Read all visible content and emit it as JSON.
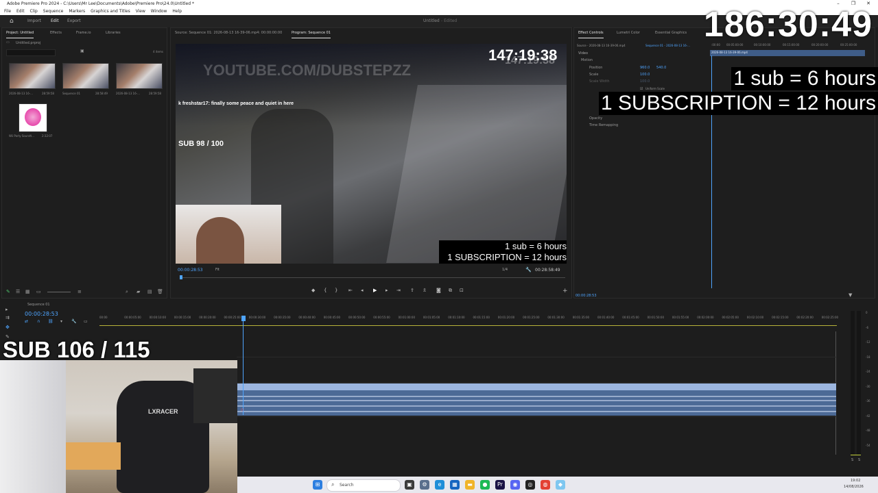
{
  "window": {
    "title": "Adobe Premiere Pro 2024 - C:\\Users\\Mr Lee\\Documents\\Adobe\\Premiere Pro\\24.0\\Untitled *",
    "minimize": "–",
    "restore": "❐",
    "close": "✕"
  },
  "menu": [
    "File",
    "Edit",
    "Clip",
    "Sequence",
    "Markers",
    "Graphics and Titles",
    "View",
    "Window",
    "Help"
  ],
  "workspace": {
    "tabs": [
      "Import",
      "Edit",
      "Export"
    ],
    "active": "Edit",
    "doc_title": "Untitled",
    "doc_status": "- Edited"
  },
  "project": {
    "tabs": [
      "Project: Untitled",
      "Effects",
      "Frame.io",
      "Libraries"
    ],
    "file": "Untitled.prproj",
    "item_count": "4 items",
    "items": [
      {
        "name": "2026-08-13 16-...",
        "duration": "28:59:58"
      },
      {
        "name": "Sequence 01",
        "duration": "28:58:49"
      },
      {
        "name": "2026-08-13 16-...",
        "duration": "28:59:58"
      },
      {
        "name": "Wii Party Soundt...",
        "duration": "2:32:07"
      }
    ]
  },
  "source_tab": "Source: Sequence 01: 2026-08-13 16-39-06.mp4: 00:00:00:00",
  "program": {
    "tab": "Program: Sequence 01",
    "timer_overlay": "147:19:38",
    "timer_overlay_ghost": "147:19:38",
    "watermark": "YOUTUBE.COM/DUBSTEPZZ",
    "chat_line": "k freshstar17: finally some peace and quiet in here",
    "sub_counter": "SUB 98 / 100",
    "rule1": "1 sub = 6 hours",
    "rule2": "1 SUBSCRIPTION = 12 hours",
    "timecode": "00:00:28:53",
    "fit": "Fit",
    "resolution": "1/4",
    "duration": "00:28:58:49"
  },
  "effect_controls": {
    "tabs": [
      "Effect Controls",
      "Lumetri Color",
      "Essential Graphics"
    ],
    "source": "Source - 2026-08-13 16-39-06.mp4",
    "sequence": "Sequence 01 - 2026-08-13 16-...",
    "clip_label": "2026-08-13 16-39-06.mp4",
    "ruler": [
      ":00:00",
      "00:05:00:00",
      "00:10:00:00",
      "00:15:00:00",
      "00:20:00:00",
      "00:25:00:00"
    ],
    "section": "Video",
    "props": [
      "Motion",
      "Position",
      "Scale",
      "Scale Width",
      "Uniform Scale",
      "Opacity",
      "Time Remapping"
    ],
    "position_x": "960.0",
    "position_y": "540.0",
    "scale": "100.0",
    "scale_width": "100.0",
    "timecode": "00:00:28:53"
  },
  "timeline": {
    "tab": "Sequence 01",
    "timecode": "00:00:28:53",
    "ruler": [
      "00:00",
      "00:00:05:00",
      "00:00:10:00",
      "00:00:15:00",
      "00:00:20:00",
      "00:00:25:00",
      "00:00:30:00",
      "00:00:35:00",
      "00:00:40:00",
      "00:00:45:00",
      "00:00:50:00",
      "00:00:55:00",
      "00:01:00:00",
      "00:01:05:00",
      "00:01:10:00",
      "00:01:15:00",
      "00:01:20:00",
      "00:01:25:00",
      "00:01:30:00",
      "00:01:35:00",
      "00:01:40:00",
      "00:01:45:00",
      "00:01:50:00",
      "00:01:55:00",
      "00:02:00:00",
      "00:02:05:00",
      "00:02:10:00",
      "00:02:15:00",
      "00:02:20:00",
      "00:02:25:00"
    ],
    "meter": [
      "0",
      "-6",
      "-12",
      "-18",
      "-24",
      "-30",
      "-36",
      "-42",
      "-48",
      "-54"
    ],
    "meter_solo": "S",
    "meter_solo2": "S"
  },
  "stream": {
    "big_timer": "186:30:49",
    "rule1": "1 sub = 6 hours",
    "rule2": "1 SUBSCRIPTION = 12 hours",
    "sub_counter": "SUB 106 / 115",
    "chair_brand": "LXRACER"
  },
  "taskbar": {
    "search": "Search",
    "time": "19:02",
    "date": "14/08/2026"
  },
  "colors": {
    "accent": "#4fa5ff",
    "panel": "#1e1e1e",
    "clip": "#9cb6df"
  }
}
